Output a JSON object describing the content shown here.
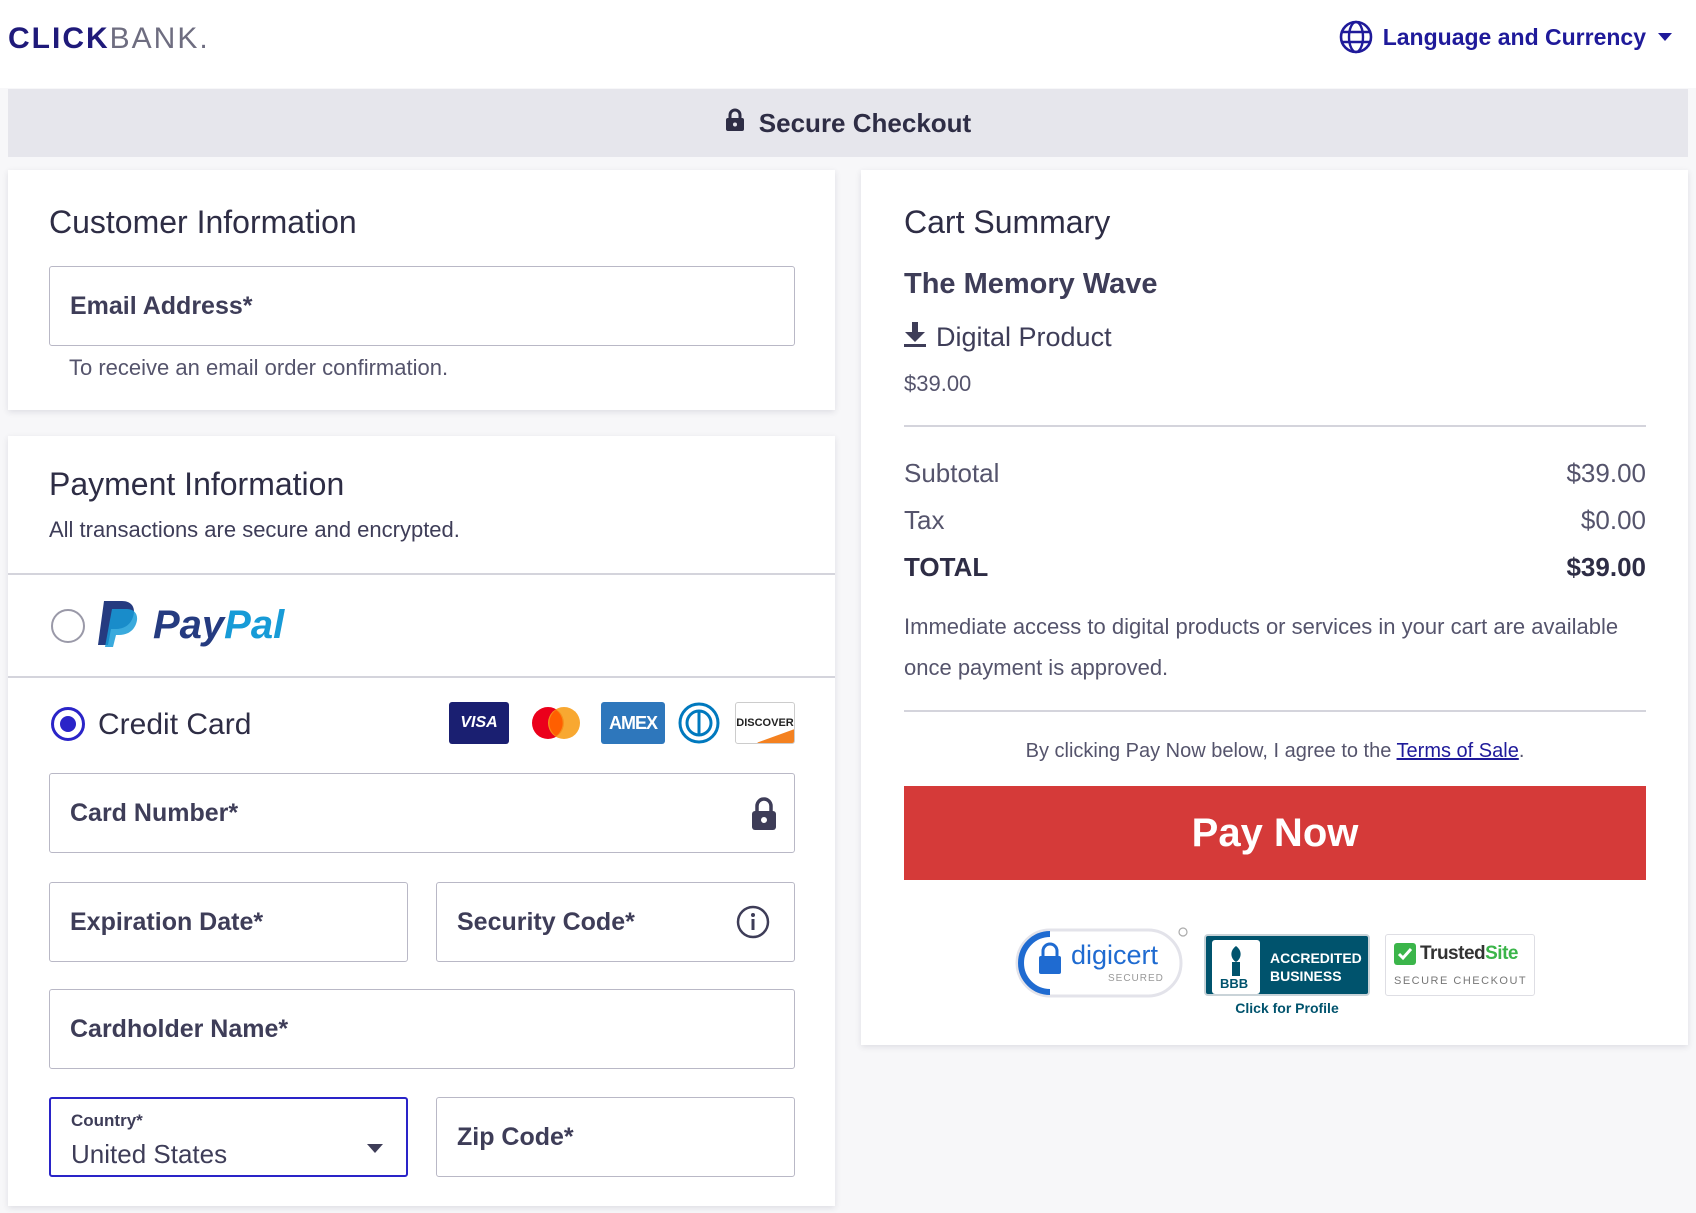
{
  "header": {
    "logo_click": "CLICK",
    "logo_bank": "BANK.",
    "language_label": "Language and Currency"
  },
  "secure_bar": {
    "label": "Secure Checkout"
  },
  "customer": {
    "title": "Customer Information",
    "email_placeholder": "Email Address*",
    "email_helper": "To receive an email order confirmation."
  },
  "payment": {
    "title": "Payment Information",
    "subtitle": "All transactions are secure and encrypted.",
    "paypal": {
      "word1": "Pay",
      "word2": "Pal",
      "selected": false
    },
    "credit_card": {
      "label": "Credit Card",
      "selected": true
    },
    "card_brands": [
      "VISA",
      "mastercard",
      "AMEX",
      "diners",
      "DISCOVER"
    ],
    "card_number_placeholder": "Card Number*",
    "expiration_placeholder": "Expiration Date*",
    "security_code_placeholder": "Security Code*",
    "cardholder_placeholder": "Cardholder Name*",
    "country_label": "Country*",
    "country_value": "United States",
    "zip_placeholder": "Zip Code*"
  },
  "cart": {
    "title": "Cart Summary",
    "product_name": "The Memory Wave",
    "product_type": "Digital Product",
    "product_price": "$39.00",
    "subtotal_label": "Subtotal",
    "subtotal_value": "$39.00",
    "tax_label": "Tax",
    "tax_value": "$0.00",
    "total_label": "TOTAL",
    "total_value": "$39.00",
    "access_note": "Immediate access to digital products or services in your cart are available once payment is approved.",
    "agree_prefix": "By clicking Pay Now below, I agree to the ",
    "terms_link": "Terms of Sale",
    "agree_suffix": ".",
    "pay_button": "Pay Now",
    "badges": {
      "digicert": "digicert",
      "digicert_sub": "SECURED",
      "bbb_line1": "ACCREDITED",
      "bbb_line2": "BUSINESS",
      "bbb_logo": "BBB",
      "bbb_profile": "Click for Profile",
      "trusted1": "Trusted",
      "trusted2": "Site",
      "trusted_sub": "SECURE CHECKOUT"
    }
  },
  "colors": {
    "brand_navy": "#1f1a7a",
    "link_blue": "#1f1a9a",
    "pay_red": "#d53a39",
    "radio_blue": "#2a24c8",
    "secure_bar_bg": "#e6e6ec"
  }
}
